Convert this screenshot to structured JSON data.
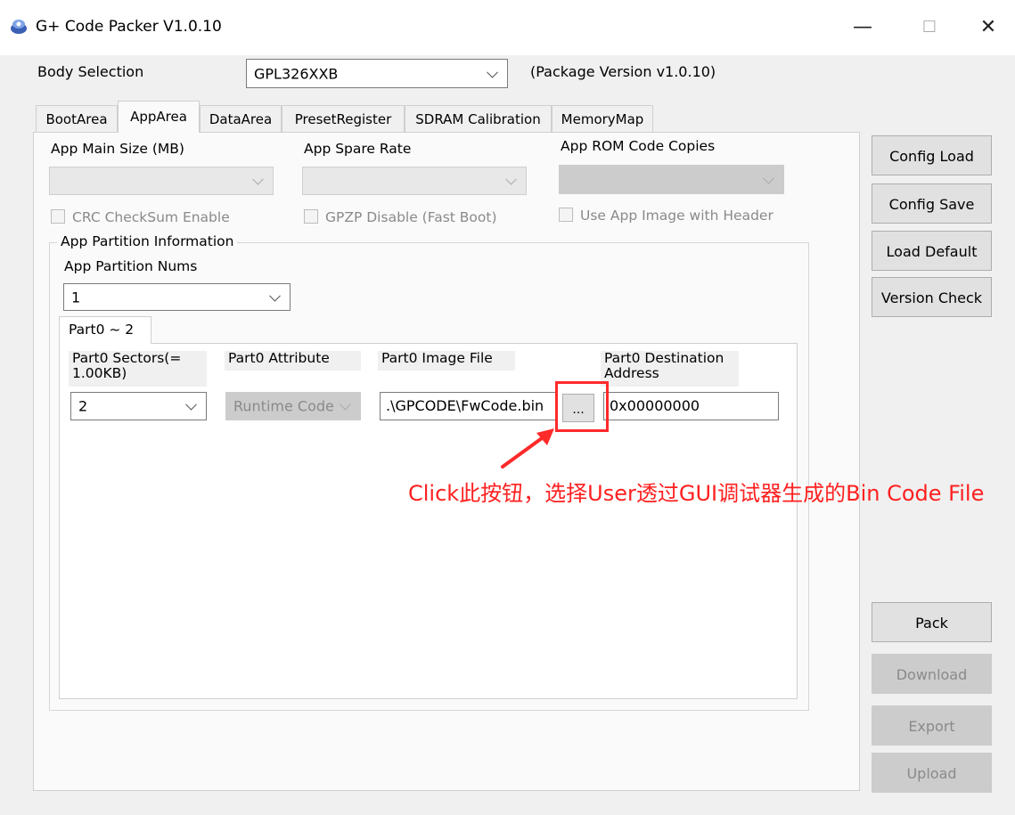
{
  "window": {
    "title": "G+ Code Packer V1.0.10",
    "minimize_glyph": "—",
    "maximize_glyph": "☐",
    "close_glyph": "✕"
  },
  "body_selection": {
    "label": "Body Selection",
    "value": "GPL326XXB",
    "package_version": "(Package Version v1.0.10)"
  },
  "tabs": [
    {
      "label": "BootArea"
    },
    {
      "label": "AppArea"
    },
    {
      "label": "DataArea"
    },
    {
      "label": "PresetRegister"
    },
    {
      "label": "SDRAM Calibration"
    },
    {
      "label": "MemoryMap"
    }
  ],
  "active_tab": "AppArea",
  "app_area": {
    "main_size_label": "App Main Size (MB)",
    "main_size_value": "",
    "spare_rate_label": "App Spare Rate",
    "spare_rate_value": "",
    "rom_copies_label": "App ROM Code Copies",
    "rom_copies_value": "",
    "crc_label": "CRC CheckSum Enable",
    "gpzp_label": "GPZP Disable (Fast Boot)",
    "header_label": "Use App Image with Header",
    "partition_group_title": "App Partition Information",
    "partition_nums_label": "App Partition Nums",
    "partition_nums_value": "1",
    "subtab_label": "Part0 ~ 2",
    "columns": {
      "sectors": "Part0 Sectors(=\n1.00KB)",
      "attribute": "Part0 Attribute",
      "image_file": "Part0 Image File",
      "destination": "Part0 Destination\nAddress"
    },
    "row": {
      "sectors": "2",
      "attribute": "Runtime Code",
      "image_file": ".\\GPCODE\\FwCode.bin",
      "browse": "...",
      "destination": "0x00000000"
    }
  },
  "right_buttons": {
    "config_load": "Config Load",
    "config_save": "Config Save",
    "load_default": "Load Default",
    "version_check": "Version Check",
    "pack": "Pack",
    "download": "Download",
    "export": "Export",
    "upload": "Upload"
  },
  "annotation": {
    "text": "Click此按钮，选择User透过GUI调试器生成的Bin Code File",
    "color": "#ff2020"
  },
  "colors": {
    "window_bg": "#f0f0f0",
    "panel_bg": "#fafafa",
    "disabled_bg": "#cccccc",
    "highlight_red": "#ff2a2a"
  }
}
